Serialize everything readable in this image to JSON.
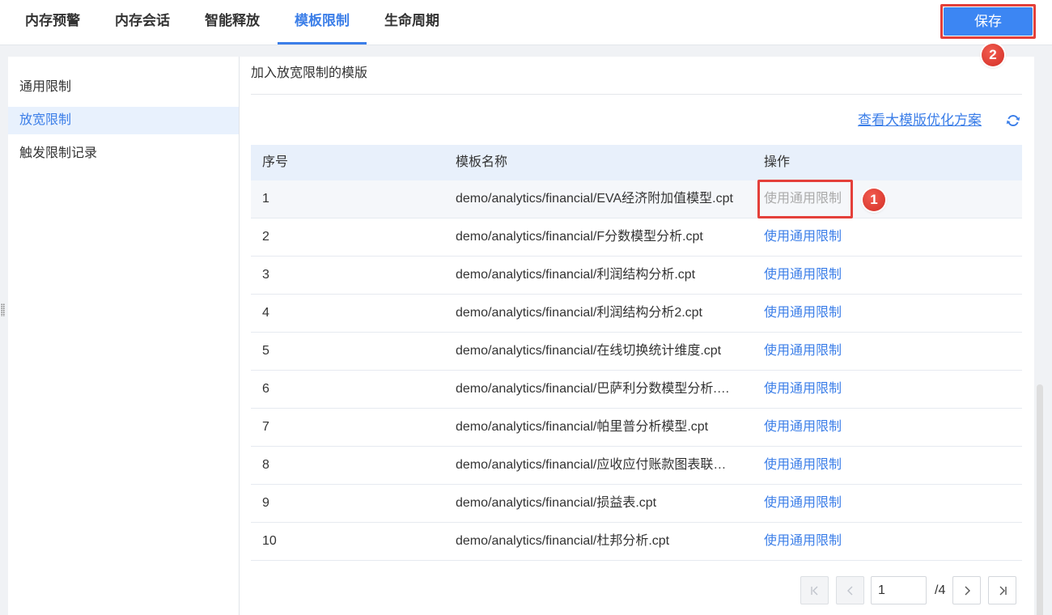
{
  "tabs": [
    {
      "label": "内存预警",
      "active": false
    },
    {
      "label": "内存会话",
      "active": false
    },
    {
      "label": "智能释放",
      "active": false
    },
    {
      "label": "模板限制",
      "active": true
    },
    {
      "label": "生命周期",
      "active": false
    }
  ],
  "save_button": {
    "label": "保存"
  },
  "annotations": {
    "step_1": "1",
    "step_2": "2"
  },
  "sidebar": {
    "items": [
      {
        "label": "通用限制",
        "active": false
      },
      {
        "label": "放宽限制",
        "active": true
      },
      {
        "label": "触发限制记录",
        "active": false
      }
    ]
  },
  "content": {
    "title": "加入放宽限制的模版",
    "optimize_link": "查看大模版优化方案"
  },
  "table": {
    "headers": [
      "序号",
      "模板名称",
      "操作"
    ],
    "rows": [
      {
        "index": "1",
        "name": "demo/analytics/financial/EVA经济附加值模型.cpt",
        "action": "使用通用限制",
        "disabled": true
      },
      {
        "index": "2",
        "name": "demo/analytics/financial/F分数模型分析.cpt",
        "action": "使用通用限制",
        "disabled": false
      },
      {
        "index": "3",
        "name": "demo/analytics/financial/利润结构分析.cpt",
        "action": "使用通用限制",
        "disabled": false
      },
      {
        "index": "4",
        "name": "demo/analytics/financial/利润结构分析2.cpt",
        "action": "使用通用限制",
        "disabled": false
      },
      {
        "index": "5",
        "name": "demo/analytics/financial/在线切换统计维度.cpt",
        "action": "使用通用限制",
        "disabled": false
      },
      {
        "index": "6",
        "name": "demo/analytics/financial/巴萨利分数模型分析.…",
        "action": "使用通用限制",
        "disabled": false
      },
      {
        "index": "7",
        "name": "demo/analytics/financial/帕里普分析模型.cpt",
        "action": "使用通用限制",
        "disabled": false
      },
      {
        "index": "8",
        "name": "demo/analytics/financial/应收应付账款图表联…",
        "action": "使用通用限制",
        "disabled": false
      },
      {
        "index": "9",
        "name": "demo/analytics/financial/损益表.cpt",
        "action": "使用通用限制",
        "disabled": false
      },
      {
        "index": "10",
        "name": "demo/analytics/financial/杜邦分析.cpt",
        "action": "使用通用限制",
        "disabled": false
      }
    ]
  },
  "pagination": {
    "current_page": "1",
    "total_label": "/4",
    "first_disabled": true,
    "prev_disabled": true,
    "next_disabled": false,
    "last_disabled": false
  },
  "icons": {
    "refresh": "refresh-icon",
    "first_page": "first-page-icon",
    "prev_page": "prev-page-icon",
    "next_page": "next-page-icon",
    "last_page": "last-page-icon",
    "resize_handle": "drag-handle-icon"
  },
  "colors": {
    "primary_blue": "#3b7ee8",
    "save_button_bg": "#3c86f3",
    "annotation_red": "#e4403a",
    "disabled_text": "#aaaaaa",
    "table_header_bg": "#e8f0fb",
    "page_bg": "#f0f2f5"
  }
}
